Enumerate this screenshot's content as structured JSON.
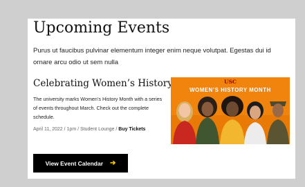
{
  "section": {
    "title": "Upcoming Events",
    "intro": "Purus ut faucibus pulvinar elementum integer enim neque volutpat. Egestas dui id ornare arcu odio ut sem nulla"
  },
  "event": {
    "title": "Celebrating Women’s History",
    "description": "The university marks Women’s History Month with a series of events throughout March. Check out the complete schedule.",
    "date": "April 11, 2022",
    "time": "1pm",
    "location": "Student Lounge",
    "separator": " / ",
    "tickets_label": "Buy Tickets",
    "image": {
      "logo_text": "USC",
      "headline": "WOMEN’S HISTORY MONTH"
    }
  },
  "calendar_button": {
    "label": "View Event Calendar",
    "icon": "arrow-right-icon"
  },
  "colors": {
    "page_background": "#cfcfcf",
    "card_background": "#ffffff",
    "button_background": "#000000",
    "accent_yellow": "#ffcc00",
    "banner_orange": "#f0840c",
    "usc_cardinal": "#990000"
  }
}
